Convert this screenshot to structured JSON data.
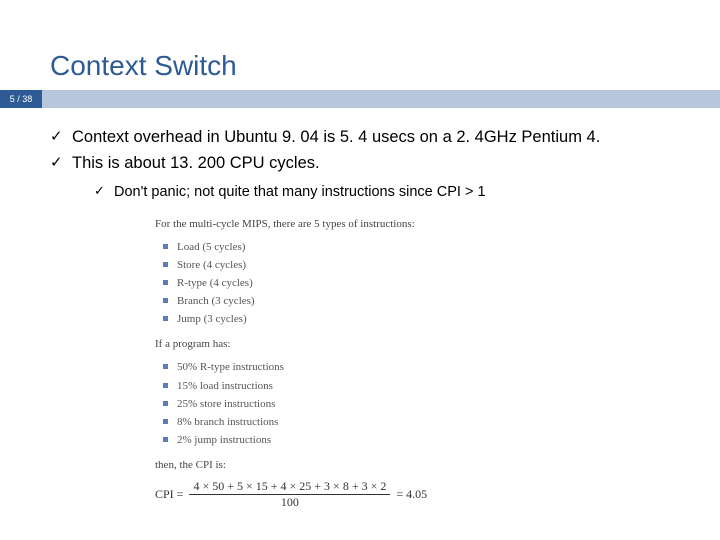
{
  "slide": {
    "title": "Context Switch",
    "page": "5 / 38",
    "bullets": [
      "Context overhead in Ubuntu 9. 04 is 5. 4 usecs on a 2. 4GHz Pentium 4.",
      "This is about 13. 200 CPU cycles."
    ],
    "sub_bullet": "Don't panic; not quite that many instructions since CPI > 1"
  },
  "figure": {
    "intro": "For the multi-cycle MIPS, there are 5 types of instructions:",
    "types": [
      "Load (5 cycles)",
      "Store (4 cycles)",
      "R-type (4 cycles)",
      "Branch (3 cycles)",
      "Jump (3 cycles)"
    ],
    "mix_intro": "If a program has:",
    "mix": [
      "50% R-type instructions",
      "15% load instructions",
      "25% store instructions",
      "8% branch instructions",
      "2% jump instructions"
    ],
    "thenline": "then, the CPI is:",
    "cpi_label": "CPI =",
    "cpi_numerator": "4 × 50 + 5 × 15 + 4 × 25 + 3 × 8 + 3 × 2",
    "cpi_denominator": "100",
    "cpi_result": "= 4.05"
  }
}
